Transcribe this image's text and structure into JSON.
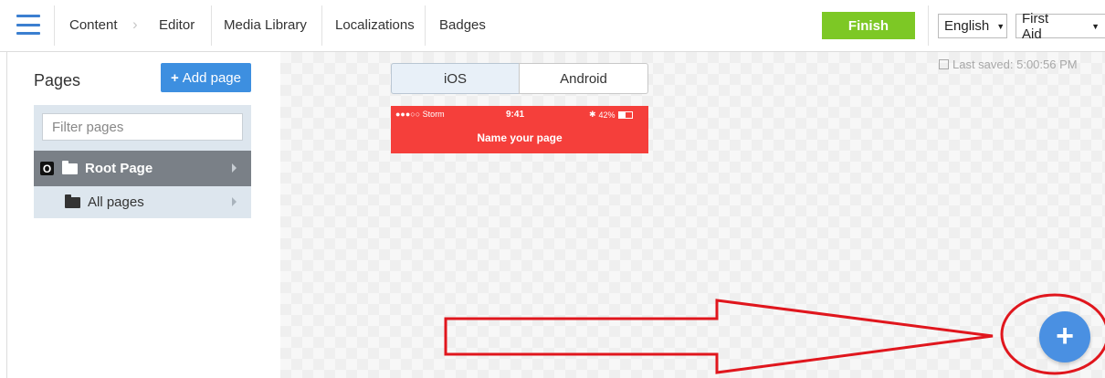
{
  "nav": {
    "items": [
      "Content",
      "Editor",
      "Media Library",
      "Localizations",
      "Badges"
    ],
    "finish_label": "Finish",
    "language": "English",
    "app": "First Aid"
  },
  "sidebar": {
    "title": "Pages",
    "add_label": "Add page",
    "filter_placeholder": "Filter pages",
    "root_badge": "O",
    "root_label": "Root Page",
    "all_label": "All pages"
  },
  "editor": {
    "tabs": [
      "iOS",
      "Android"
    ],
    "status_carrier": "●●●○○ Storm",
    "status_time": "9:41",
    "status_battery": "42%",
    "page_name": "Name your page",
    "last_saved": "Last saved: 5:00:56 PM"
  },
  "colors": {
    "accent": "#3d8fe0",
    "finish": "#7dc825",
    "phone_bar": "#f53f3b",
    "annotation": "#e0161d"
  }
}
